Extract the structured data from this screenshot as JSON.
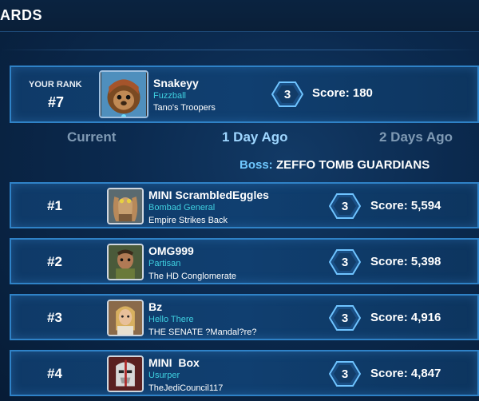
{
  "header": {
    "title": "ARDS"
  },
  "my_rank": {
    "label": "YOUR RANK",
    "rank": "#7",
    "name": "Snakeyy",
    "character": "Fuzzball",
    "guild": "Tano's Troopers",
    "tier": "3",
    "score": "Score: 180",
    "avatar_icon": "ewok-icon"
  },
  "tabs": [
    {
      "label": "Current",
      "active": false
    },
    {
      "label": "1 Day Ago",
      "active": true
    },
    {
      "label": "2 Days Ago",
      "active": false
    }
  ],
  "boss": {
    "label": "Boss:",
    "name": "ZEFFO TOMB GUARDIANS"
  },
  "leaderboard": [
    {
      "rank": "#1",
      "name": "MINI ScrambledEggles",
      "character": "Bombad General",
      "guild": "Empire Strikes Back",
      "tier": "3",
      "score": "Score: 5,594",
      "avatar_icon": "gungan-icon"
    },
    {
      "rank": "#2",
      "name": "OMG999",
      "character": "Partisan",
      "guild": "The HD Conglomerate",
      "tier": "3",
      "score": "Score: 5,398",
      "avatar_icon": "partisan-icon"
    },
    {
      "rank": "#3",
      "name": "Bz",
      "character": "Hello There",
      "guild": "THE SENATE ?Mandal?re?",
      "tier": "3",
      "score": "Score: 4,916",
      "avatar_icon": "human-icon"
    },
    {
      "rank": "#4",
      "name": "MINI  Box",
      "character": "Usurper",
      "guild": "TheJediCouncil117",
      "tier": "3",
      "score": "Score: 4,847",
      "avatar_icon": "trooper-icon"
    }
  ],
  "colors": {
    "accent": "#2f82c7",
    "subtitle": "#3fd0e0",
    "boss_label": "#6fc8ff"
  }
}
